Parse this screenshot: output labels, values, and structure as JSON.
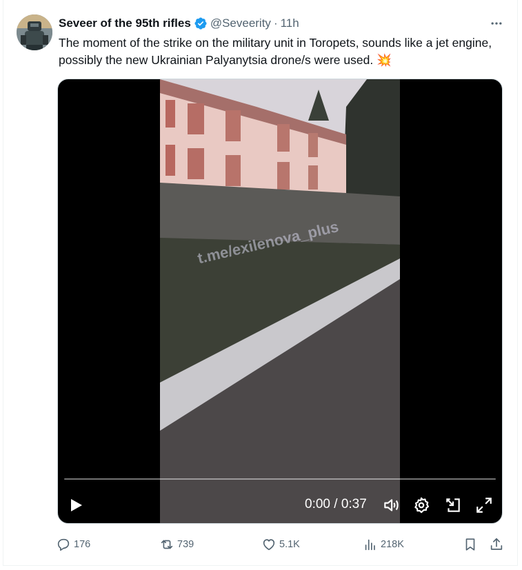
{
  "author": {
    "display_name": "Seveer of the 95th rifles",
    "handle": "@Seveerity",
    "time_ago": "11h"
  },
  "tweet": {
    "text": "The moment of the strike on the military unit in Toropets, sounds like a jet engine, possibly the new Ukrainian Palyanytsia drone/s were used.",
    "emoji": "💥"
  },
  "video": {
    "watermark": "t.me/exilenova_plus",
    "current_time": "0:00",
    "duration": "0:37",
    "timecode": "0:00 / 0:37",
    "progress": 0
  },
  "stats": {
    "replies": "176",
    "reposts": "739",
    "likes": "5.1K",
    "views": "218K"
  },
  "icons": {
    "verified": "verified-badge-icon",
    "more": "more-icon",
    "play": "play-icon",
    "volume": "volume-icon",
    "settings": "settings-icon",
    "dock": "dock-icon",
    "fullscreen": "fullscreen-icon",
    "reply": "reply-icon",
    "repost": "repost-icon",
    "like": "like-icon",
    "views": "views-icon",
    "bookmark": "bookmark-icon",
    "share": "share-icon"
  },
  "colors": {
    "accent": "#1d9bf0",
    "muted": "#536471",
    "text": "#0f1419"
  }
}
